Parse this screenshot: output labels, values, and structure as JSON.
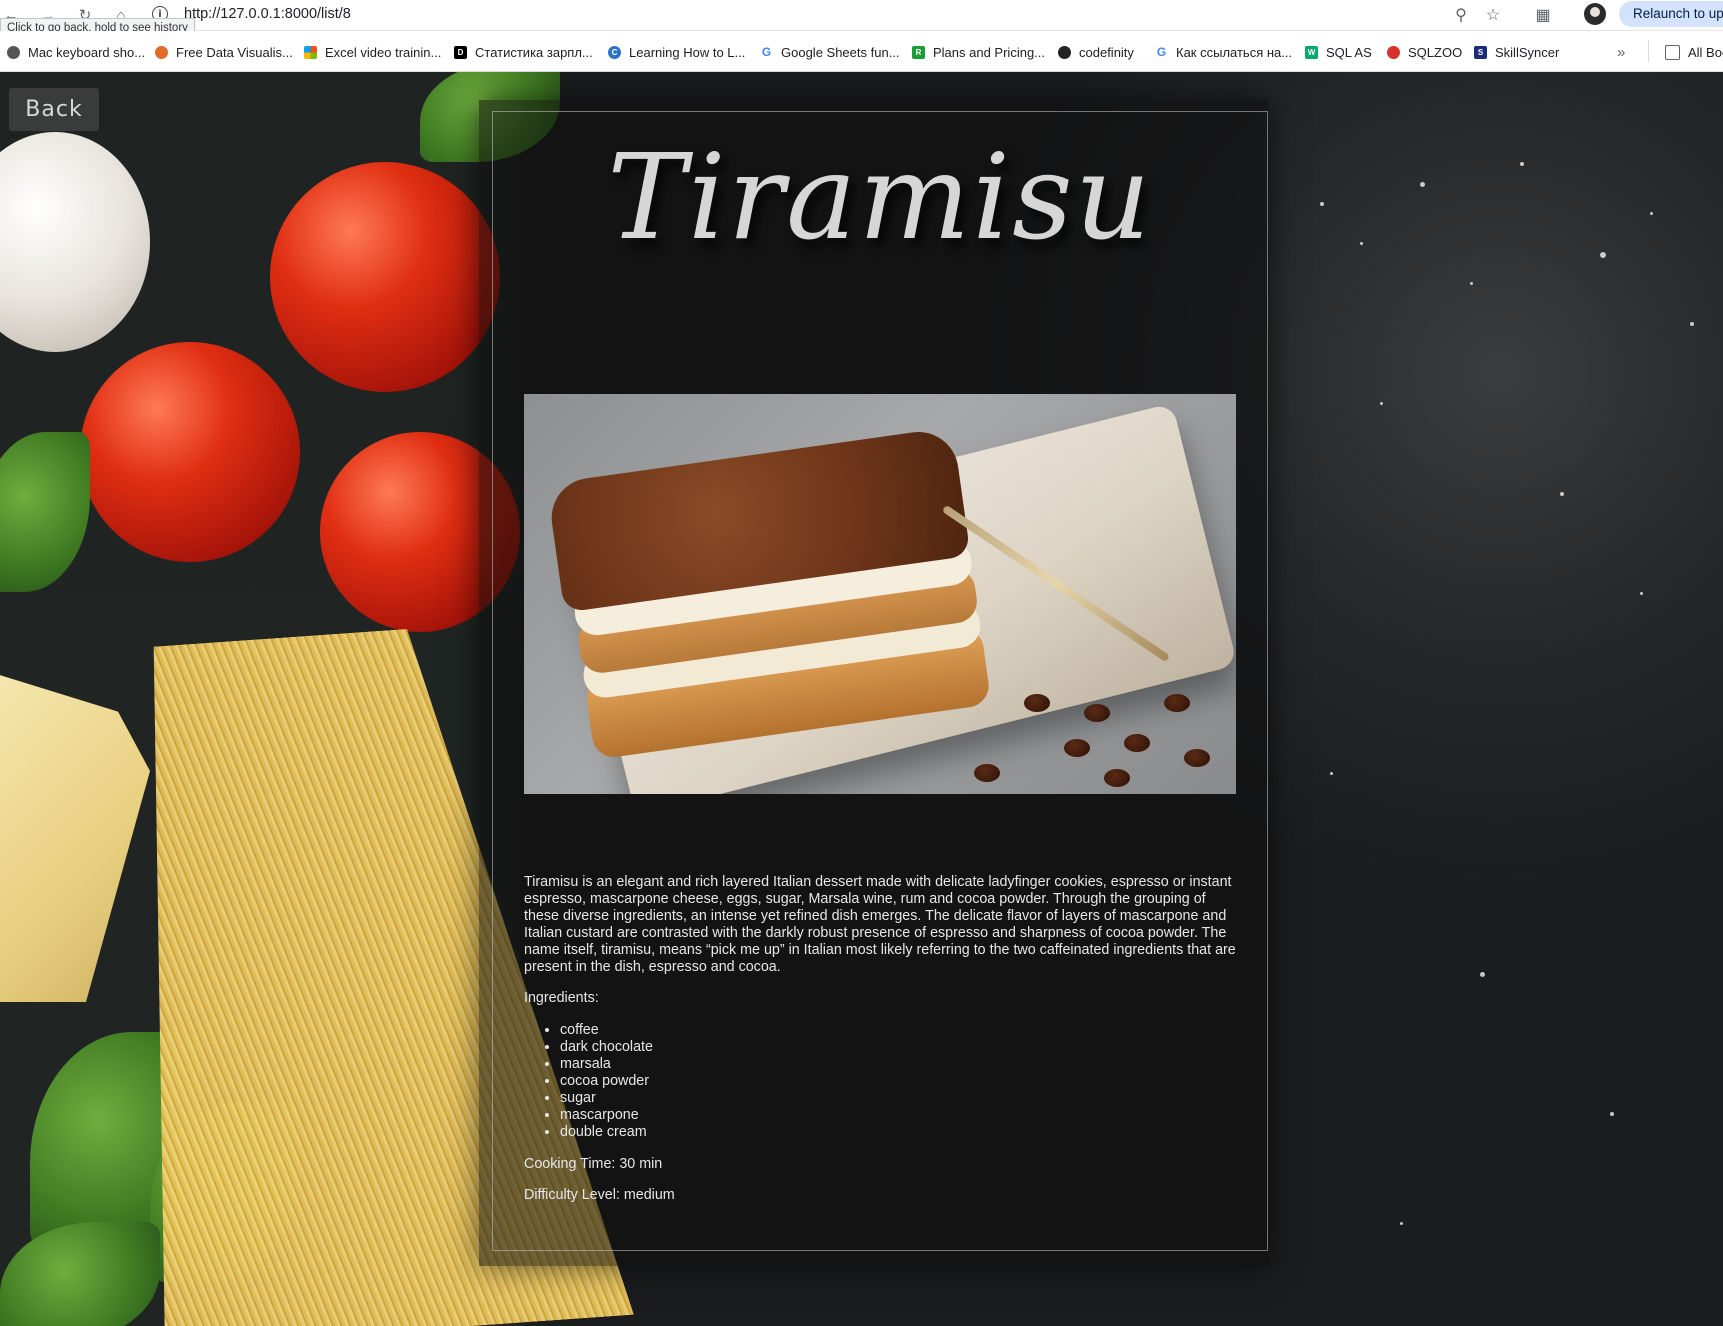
{
  "browser": {
    "url": "http://127.0.0.1:8000/list/8",
    "back_tooltip": "Click to go back, hold to see history",
    "relaunch_label": "Relaunch to up",
    "bookmarks": [
      {
        "label": "Mac keyboard sho...",
        "icon": "apple-icon",
        "color": "#555555"
      },
      {
        "label": "Free Data Visualis...",
        "icon": "datawrapper-icon",
        "color": "#e06c2c"
      },
      {
        "label": "Excel video trainin...",
        "icon": "microsoft-icon",
        "color": "#f25022"
      },
      {
        "label": "Статистика зарпл...",
        "icon": "dou-icon",
        "color": "#000000"
      },
      {
        "label": "Learning How to L...",
        "icon": "coursera-icon",
        "color": "#2a73cc"
      },
      {
        "label": "Google Sheets fun...",
        "icon": "google-icon",
        "color": "#4285f4"
      },
      {
        "label": "Plans and Pricing...",
        "icon": "plans-icon",
        "color": "#1a9e3a"
      },
      {
        "label": "codefinity",
        "icon": "codefinity-icon",
        "color": "#222222"
      },
      {
        "label": "Как ссылаться на...",
        "icon": "google-icon",
        "color": "#4285f4"
      },
      {
        "label": "SQL AS",
        "icon": "w3-icon",
        "color": "#04aa6d"
      },
      {
        "label": "SQLZOO",
        "icon": "sqlzoo-icon",
        "color": "#d6312b"
      },
      {
        "label": "SkillSyncer",
        "icon": "skillsyncer-icon",
        "color": "#1c2a7a"
      }
    ],
    "all_bookmarks_label": "All Boo"
  },
  "page": {
    "back_label": "Back",
    "title": "Tiramisu",
    "image_alt": "tiramisu-photo",
    "description": "Tiramisu is an elegant and rich layered Italian dessert made with delicate ladyfinger cookies, espresso or instant espresso, mascarpone cheese, eggs, sugar, Marsala wine, rum and cocoa powder. Through the grouping of these diverse ingredients, an intense yet refined dish emerges. The delicate flavor of layers of mascarpone and Italian custard are contrasted with the darkly robust presence of espresso and sharpness of cocoa powder. The name itself, tiramisu, means “pick me up” in Italian most likely referring to the two caffeinated ingredients that are present in the dish, espresso and cocoa.",
    "ingredients_label": "Ingredients:",
    "ingredients": [
      "coffee",
      "dark chocolate",
      "marsala",
      "cocoa powder",
      "sugar",
      "mascarpone",
      "double cream"
    ],
    "cooking_time": "Cooking Time: 30 min",
    "difficulty": "Difficulty Level: medium"
  }
}
